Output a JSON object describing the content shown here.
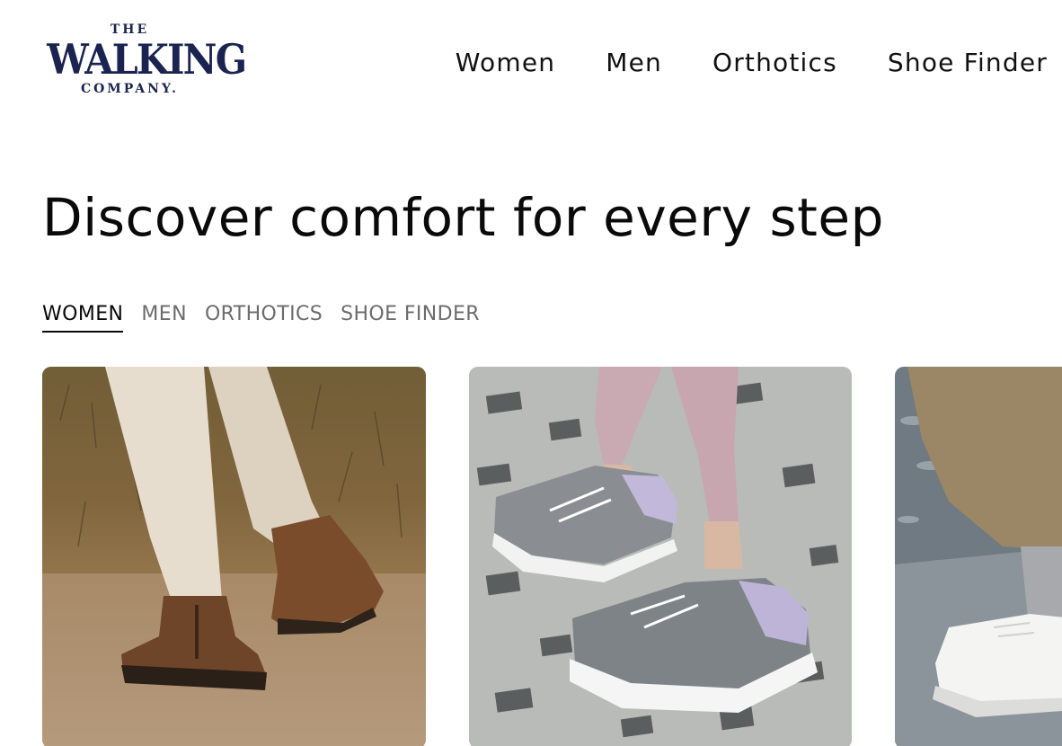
{
  "header": {
    "logo": {
      "line1": "THE",
      "line2": "WALKING",
      "line3": "COMPANY."
    },
    "nav": [
      {
        "label": "Women"
      },
      {
        "label": "Men"
      },
      {
        "label": "Orthotics"
      },
      {
        "label": "Shoe Finder"
      }
    ]
  },
  "hero": {
    "headline": "Discover comfort for every step"
  },
  "tabs": [
    {
      "label": "WOMEN",
      "active": true
    },
    {
      "label": "MEN",
      "active": false
    },
    {
      "label": "ORTHOTICS",
      "active": false
    },
    {
      "label": "SHOE FINDER",
      "active": false
    }
  ],
  "colors": {
    "brand": "#1b2450",
    "text": "#111111",
    "muted_tab": "#6c6c6c"
  }
}
